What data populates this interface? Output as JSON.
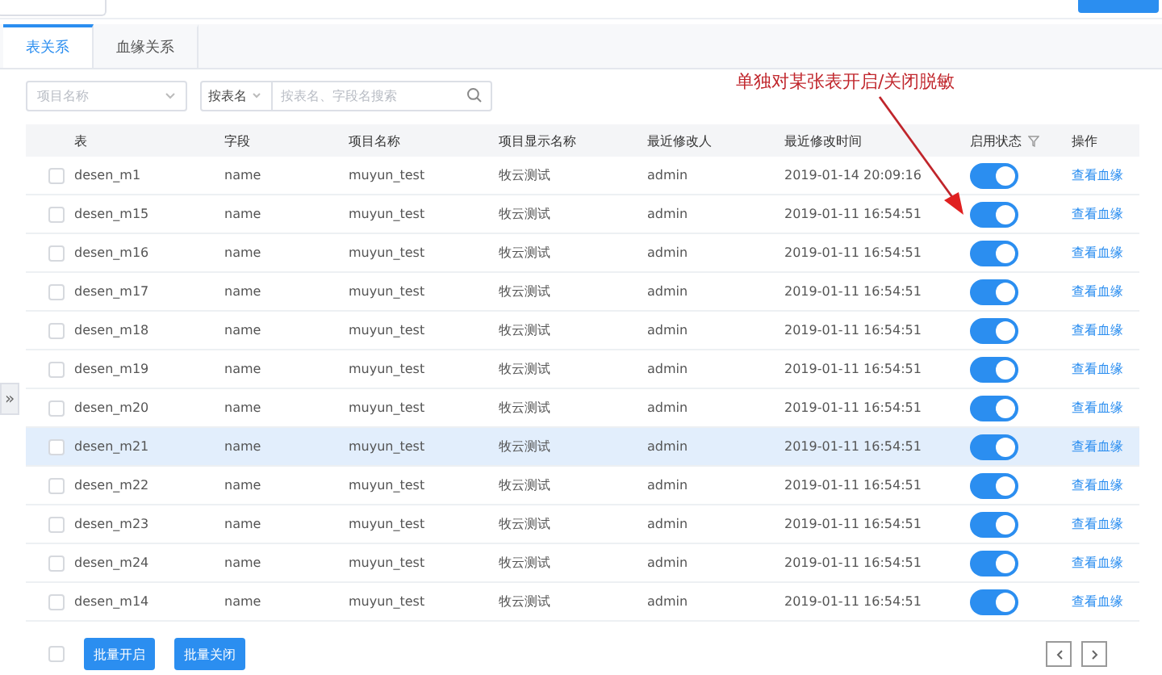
{
  "tabs": [
    {
      "label": "表关系",
      "selected": true
    },
    {
      "label": "血缘关系",
      "selected": false
    }
  ],
  "filters": {
    "project": {
      "placeholder": "项目名称"
    },
    "search_mode": {
      "value": "按表名"
    },
    "search": {
      "placeholder": "按表名、字段名搜索"
    }
  },
  "annotation": {
    "text": "单独对某张表开启/关闭脱敏"
  },
  "table": {
    "columns": [
      "表",
      "字段",
      "项目名称",
      "项目显示名称",
      "最近修改人",
      "最近修改时间",
      "启用状态",
      "操作"
    ],
    "rows": [
      {
        "cells": [
          "desen_m1",
          "name",
          "muyun_test",
          "牧云测试",
          "admin",
          "2019-01-14 20:09:16"
        ],
        "checked": false,
        "selected": false,
        "on": true,
        "action": "查看血缘"
      },
      {
        "cells": [
          "desen_m15",
          "name",
          "muyun_test",
          "牧云测试",
          "admin",
          "2019-01-11 16:54:51"
        ],
        "checked": false,
        "selected": false,
        "on": true,
        "action": "查看血缘"
      },
      {
        "cells": [
          "desen_m16",
          "name",
          "muyun_test",
          "牧云测试",
          "admin",
          "2019-01-11 16:54:51"
        ],
        "checked": false,
        "selected": false,
        "on": true,
        "action": "查看血缘"
      },
      {
        "cells": [
          "desen_m17",
          "name",
          "muyun_test",
          "牧云测试",
          "admin",
          "2019-01-11 16:54:51"
        ],
        "checked": false,
        "selected": false,
        "on": true,
        "action": "查看血缘"
      },
      {
        "cells": [
          "desen_m18",
          "name",
          "muyun_test",
          "牧云测试",
          "admin",
          "2019-01-11 16:54:51"
        ],
        "checked": false,
        "selected": false,
        "on": true,
        "action": "查看血缘"
      },
      {
        "cells": [
          "desen_m19",
          "name",
          "muyun_test",
          "牧云测试",
          "admin",
          "2019-01-11 16:54:51"
        ],
        "checked": false,
        "selected": false,
        "on": true,
        "action": "查看血缘"
      },
      {
        "cells": [
          "desen_m20",
          "name",
          "muyun_test",
          "牧云测试",
          "admin",
          "2019-01-11 16:54:51"
        ],
        "checked": false,
        "selected": false,
        "on": true,
        "action": "查看血缘"
      },
      {
        "cells": [
          "desen_m21",
          "name",
          "muyun_test",
          "牧云测试",
          "admin",
          "2019-01-11 16:54:51"
        ],
        "checked": false,
        "selected": true,
        "on": true,
        "action": "查看血缘"
      },
      {
        "cells": [
          "desen_m22",
          "name",
          "muyun_test",
          "牧云测试",
          "admin",
          "2019-01-11 16:54:51"
        ],
        "checked": false,
        "selected": false,
        "on": true,
        "action": "查看血缘"
      },
      {
        "cells": [
          "desen_m23",
          "name",
          "muyun_test",
          "牧云测试",
          "admin",
          "2019-01-11 16:54:51"
        ],
        "checked": false,
        "selected": false,
        "on": true,
        "action": "查看血缘"
      },
      {
        "cells": [
          "desen_m24",
          "name",
          "muyun_test",
          "牧云测试",
          "admin",
          "2019-01-11 16:54:51"
        ],
        "checked": false,
        "selected": false,
        "on": true,
        "action": "查看血缘"
      },
      {
        "cells": [
          "desen_m14",
          "name",
          "muyun_test",
          "牧云测试",
          "admin",
          "2019-01-11 16:54:51"
        ],
        "checked": false,
        "selected": false,
        "on": true,
        "action": "查看血缘"
      }
    ]
  },
  "footer": {
    "select_all_checked": false,
    "buttons": [
      "批量开启",
      "批量关闭"
    ]
  },
  "expand_handle": "»"
}
